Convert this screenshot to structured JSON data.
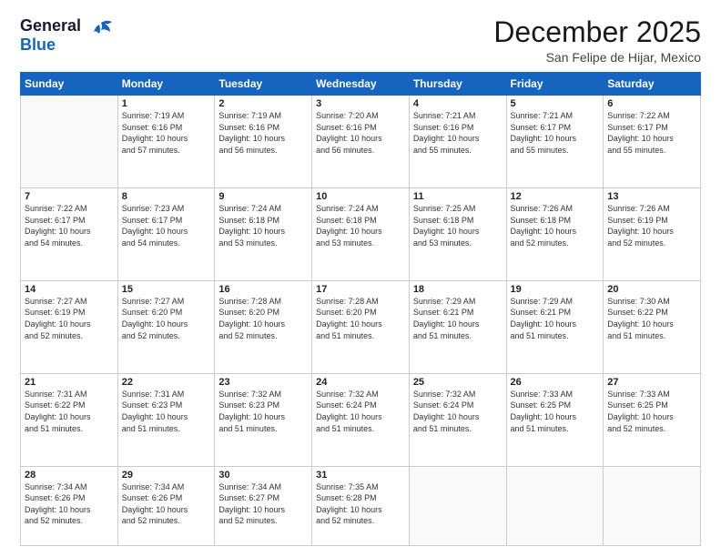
{
  "header": {
    "logo_line1": "General",
    "logo_line2": "Blue",
    "month": "December 2025",
    "location": "San Felipe de Hijar, Mexico"
  },
  "weekdays": [
    "Sunday",
    "Monday",
    "Tuesday",
    "Wednesday",
    "Thursday",
    "Friday",
    "Saturday"
  ],
  "weeks": [
    [
      {
        "day": "",
        "info": ""
      },
      {
        "day": "1",
        "info": "Sunrise: 7:19 AM\nSunset: 6:16 PM\nDaylight: 10 hours\nand 57 minutes."
      },
      {
        "day": "2",
        "info": "Sunrise: 7:19 AM\nSunset: 6:16 PM\nDaylight: 10 hours\nand 56 minutes."
      },
      {
        "day": "3",
        "info": "Sunrise: 7:20 AM\nSunset: 6:16 PM\nDaylight: 10 hours\nand 56 minutes."
      },
      {
        "day": "4",
        "info": "Sunrise: 7:21 AM\nSunset: 6:16 PM\nDaylight: 10 hours\nand 55 minutes."
      },
      {
        "day": "5",
        "info": "Sunrise: 7:21 AM\nSunset: 6:17 PM\nDaylight: 10 hours\nand 55 minutes."
      },
      {
        "day": "6",
        "info": "Sunrise: 7:22 AM\nSunset: 6:17 PM\nDaylight: 10 hours\nand 55 minutes."
      }
    ],
    [
      {
        "day": "7",
        "info": "Sunrise: 7:22 AM\nSunset: 6:17 PM\nDaylight: 10 hours\nand 54 minutes."
      },
      {
        "day": "8",
        "info": "Sunrise: 7:23 AM\nSunset: 6:17 PM\nDaylight: 10 hours\nand 54 minutes."
      },
      {
        "day": "9",
        "info": "Sunrise: 7:24 AM\nSunset: 6:18 PM\nDaylight: 10 hours\nand 53 minutes."
      },
      {
        "day": "10",
        "info": "Sunrise: 7:24 AM\nSunset: 6:18 PM\nDaylight: 10 hours\nand 53 minutes."
      },
      {
        "day": "11",
        "info": "Sunrise: 7:25 AM\nSunset: 6:18 PM\nDaylight: 10 hours\nand 53 minutes."
      },
      {
        "day": "12",
        "info": "Sunrise: 7:26 AM\nSunset: 6:18 PM\nDaylight: 10 hours\nand 52 minutes."
      },
      {
        "day": "13",
        "info": "Sunrise: 7:26 AM\nSunset: 6:19 PM\nDaylight: 10 hours\nand 52 minutes."
      }
    ],
    [
      {
        "day": "14",
        "info": "Sunrise: 7:27 AM\nSunset: 6:19 PM\nDaylight: 10 hours\nand 52 minutes."
      },
      {
        "day": "15",
        "info": "Sunrise: 7:27 AM\nSunset: 6:20 PM\nDaylight: 10 hours\nand 52 minutes."
      },
      {
        "day": "16",
        "info": "Sunrise: 7:28 AM\nSunset: 6:20 PM\nDaylight: 10 hours\nand 52 minutes."
      },
      {
        "day": "17",
        "info": "Sunrise: 7:28 AM\nSunset: 6:20 PM\nDaylight: 10 hours\nand 51 minutes."
      },
      {
        "day": "18",
        "info": "Sunrise: 7:29 AM\nSunset: 6:21 PM\nDaylight: 10 hours\nand 51 minutes."
      },
      {
        "day": "19",
        "info": "Sunrise: 7:29 AM\nSunset: 6:21 PM\nDaylight: 10 hours\nand 51 minutes."
      },
      {
        "day": "20",
        "info": "Sunrise: 7:30 AM\nSunset: 6:22 PM\nDaylight: 10 hours\nand 51 minutes."
      }
    ],
    [
      {
        "day": "21",
        "info": "Sunrise: 7:31 AM\nSunset: 6:22 PM\nDaylight: 10 hours\nand 51 minutes."
      },
      {
        "day": "22",
        "info": "Sunrise: 7:31 AM\nSunset: 6:23 PM\nDaylight: 10 hours\nand 51 minutes."
      },
      {
        "day": "23",
        "info": "Sunrise: 7:32 AM\nSunset: 6:23 PM\nDaylight: 10 hours\nand 51 minutes."
      },
      {
        "day": "24",
        "info": "Sunrise: 7:32 AM\nSunset: 6:24 PM\nDaylight: 10 hours\nand 51 minutes."
      },
      {
        "day": "25",
        "info": "Sunrise: 7:32 AM\nSunset: 6:24 PM\nDaylight: 10 hours\nand 51 minutes."
      },
      {
        "day": "26",
        "info": "Sunrise: 7:33 AM\nSunset: 6:25 PM\nDaylight: 10 hours\nand 51 minutes."
      },
      {
        "day": "27",
        "info": "Sunrise: 7:33 AM\nSunset: 6:25 PM\nDaylight: 10 hours\nand 52 minutes."
      }
    ],
    [
      {
        "day": "28",
        "info": "Sunrise: 7:34 AM\nSunset: 6:26 PM\nDaylight: 10 hours\nand 52 minutes."
      },
      {
        "day": "29",
        "info": "Sunrise: 7:34 AM\nSunset: 6:26 PM\nDaylight: 10 hours\nand 52 minutes."
      },
      {
        "day": "30",
        "info": "Sunrise: 7:34 AM\nSunset: 6:27 PM\nDaylight: 10 hours\nand 52 minutes."
      },
      {
        "day": "31",
        "info": "Sunrise: 7:35 AM\nSunset: 6:28 PM\nDaylight: 10 hours\nand 52 minutes."
      },
      {
        "day": "",
        "info": ""
      },
      {
        "day": "",
        "info": ""
      },
      {
        "day": "",
        "info": ""
      }
    ]
  ]
}
